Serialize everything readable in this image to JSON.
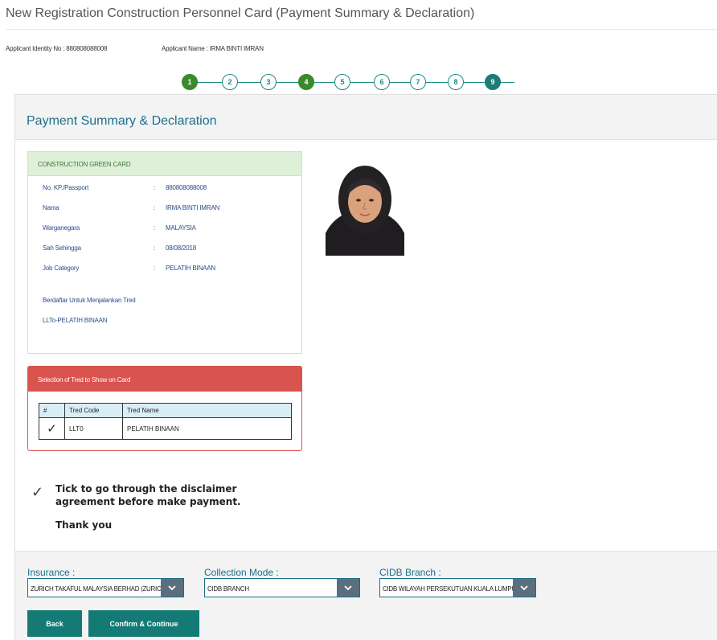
{
  "page": {
    "title": "New Registration Construction Personnel Card (Payment Summary & Declaration)"
  },
  "applicant": {
    "identity": "Applicant Identity No : 880808088008",
    "name": "Applicant Name : IRMA BINTI IMRAN"
  },
  "stepper": {
    "steps": [
      "1",
      "2",
      "3",
      "4",
      "5",
      "6",
      "7",
      "8",
      "9"
    ],
    "completed": [
      "1",
      "4"
    ],
    "current": "9"
  },
  "panel": {
    "title": "Payment Summary & Declaration"
  },
  "green_card": {
    "header": "CONSTRUCTION GREEN CARD",
    "separator": ":",
    "fields": [
      {
        "label": "No. KP./Passport",
        "value": "880808088008"
      },
      {
        "label": "Nama",
        "value": "IRMA BINTI IMRAN"
      },
      {
        "label": "Warganegara",
        "value": "MALAYSIA"
      },
      {
        "label": "Sah Sehingga",
        "value": "08/08/2018"
      },
      {
        "label": "Job Category",
        "value": "PELATIH BINAAN"
      }
    ],
    "trade_heading": "Berdaftar Untuk Menjalankan Tred",
    "trade_value": "LLTo-PELATIH BINAAN"
  },
  "tred": {
    "header": "Selection of Tred to Show on Card",
    "columns": [
      "#",
      "Tred Code",
      "Tred Name"
    ],
    "rows": [
      {
        "checked": "✓",
        "code": "LLT0",
        "name": "PELATIH BINAAN"
      }
    ]
  },
  "disclaimer": {
    "check": "✓",
    "text": "Tick to go through the disclaimer agreement before make payment.",
    "thanks": "Thank you"
  },
  "form": {
    "insurance": {
      "label": "Insurance :",
      "value": "ZURICH TAKAFUL MALAYSIA BERHAD (ZURICH)"
    },
    "collection": {
      "label": "Collection Mode :",
      "value": "CIDB BRANCH"
    },
    "branch": {
      "label": "CIDB Branch :",
      "value": "CIDB WILAYAH PERSEKUTUAN KUALA LUMPUR"
    },
    "arrow_icon": "chevron-down-icon"
  },
  "buttons": {
    "back": "Back",
    "confirm": "Confirm & Continue"
  },
  "colors": {
    "accent": "#137a75",
    "title_blue": "#1b6f8c",
    "step_done": "#3a8a2c",
    "danger": "#d9534f",
    "success_bg": "#dff0d8"
  }
}
